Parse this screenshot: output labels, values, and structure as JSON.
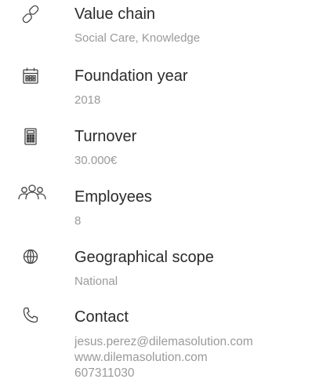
{
  "items": [
    {
      "icon": "link-icon",
      "title": "Value chain",
      "value": "Social Care, Knowledge"
    },
    {
      "icon": "calendar-icon",
      "title": "Foundation year",
      "value": "2018"
    },
    {
      "icon": "calculator-icon",
      "title": "Turnover",
      "value": "30.000€"
    },
    {
      "icon": "people-icon",
      "title": "Employees",
      "value": "8"
    },
    {
      "icon": "globe-icon",
      "title": "Geographical scope",
      "value": "National"
    }
  ],
  "contact": {
    "icon": "phone-icon",
    "title": "Contact",
    "email": "jesus.perez@dilemasolution.com",
    "website": "www.dilemasolution.com",
    "phone": "607311030"
  }
}
